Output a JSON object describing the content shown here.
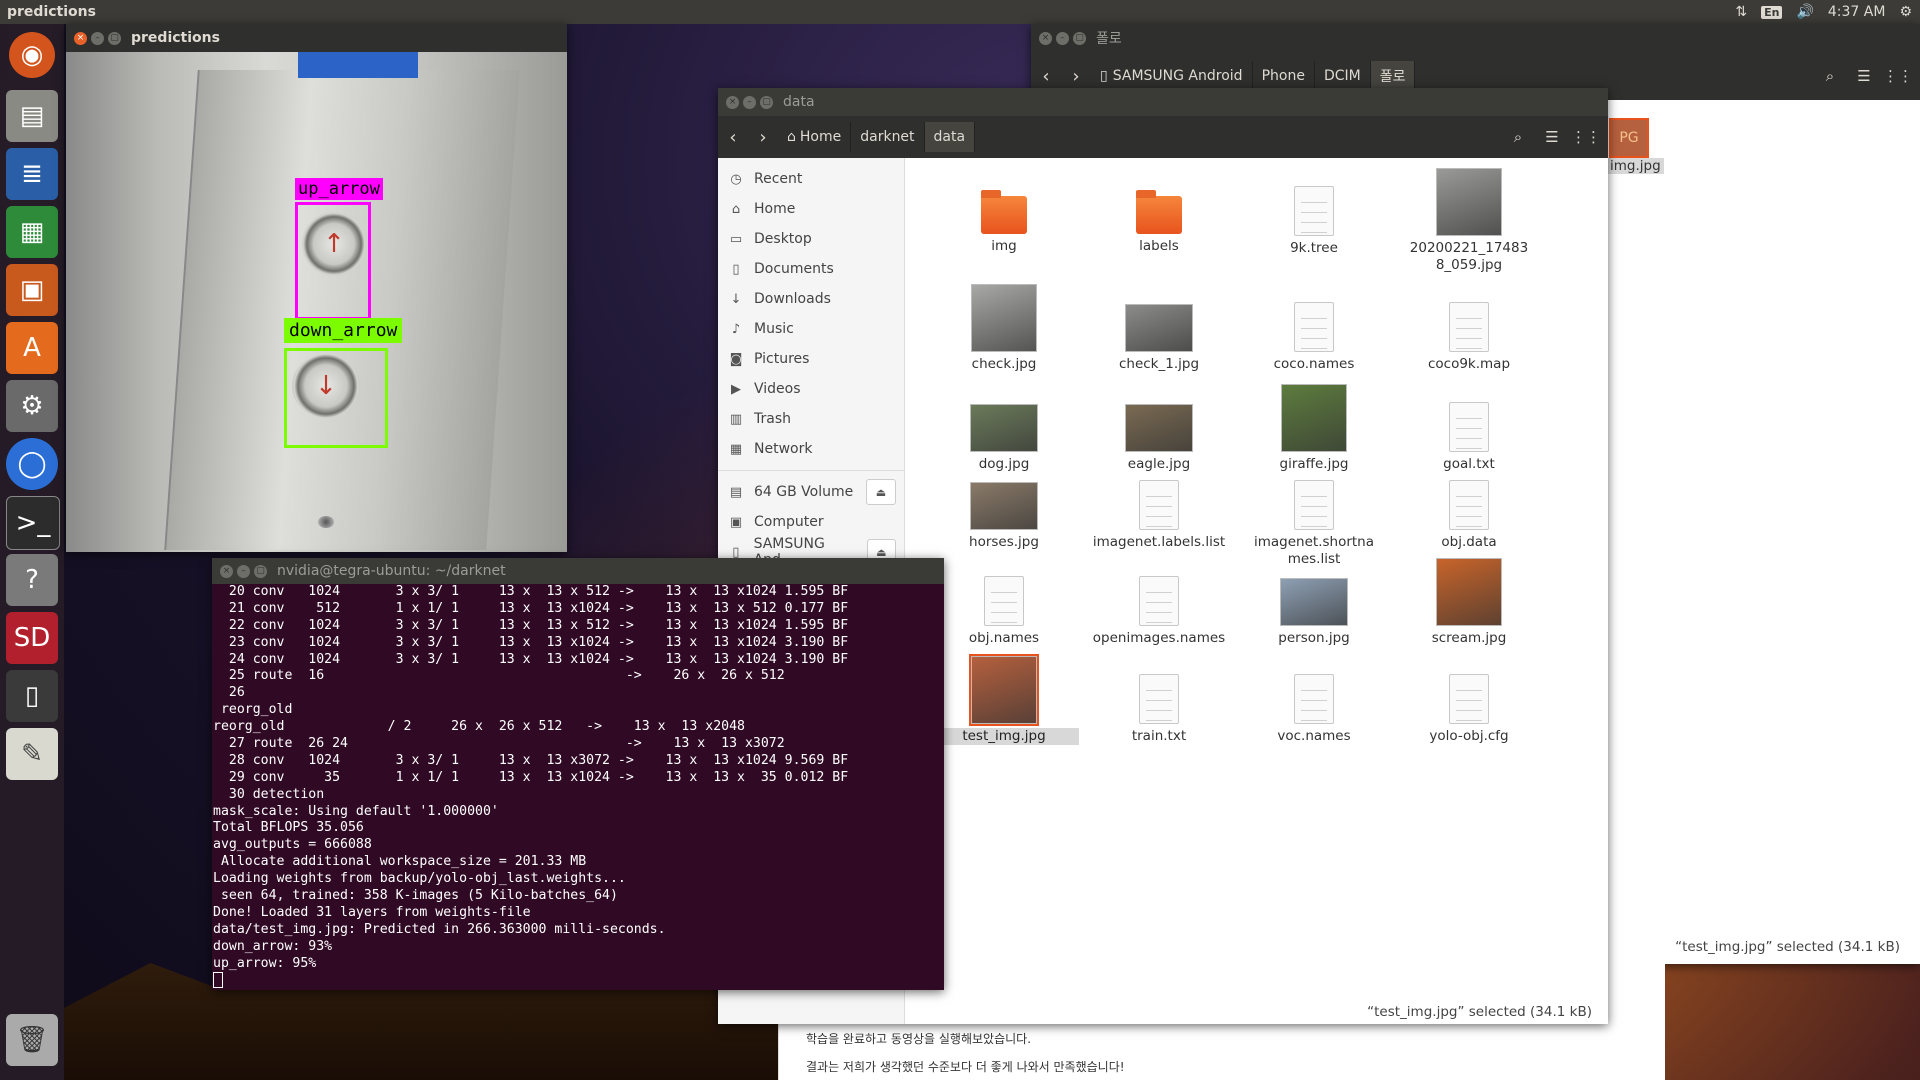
{
  "topbar": {
    "app_title": "predictions",
    "lang": "En",
    "time": "4:37 AM"
  },
  "launcher": {
    "items": [
      "ubuntu-dash-icon",
      "files-icon",
      "writer-icon",
      "calc-icon",
      "impress-icon",
      "software-center-icon",
      "settings-icon",
      "chromium-icon",
      "terminal-icon",
      "help-icon",
      "sd-card-icon",
      "phone-icon",
      "text-editor-icon",
      "trash-icon"
    ]
  },
  "predictions_window": {
    "title": "predictions",
    "detections": [
      {
        "label": "up_arrow",
        "color": "#ff00ff"
      },
      {
        "label": "down_arrow",
        "color": "#7cfc00"
      }
    ]
  },
  "terminal": {
    "title": "nvidia@tegra-ubuntu: ~/darknet",
    "lines": [
      "  20 conv   1024       3 x 3/ 1     13 x  13 x 512 ->    13 x  13 x1024 1.595 BF",
      "  21 conv    512       1 x 1/ 1     13 x  13 x1024 ->    13 x  13 x 512 0.177 BF",
      "  22 conv   1024       3 x 3/ 1     13 x  13 x 512 ->    13 x  13 x1024 1.595 BF",
      "  23 conv   1024       3 x 3/ 1     13 x  13 x1024 ->    13 x  13 x1024 3.190 BF",
      "  24 conv   1024       3 x 3/ 1     13 x  13 x1024 ->    13 x  13 x1024 3.190 BF",
      "  25 route  16                                      ->    26 x  26 x 512",
      "  26",
      " reorg_old",
      "reorg_old             / 2     26 x  26 x 512   ->    13 x  13 x2048",
      "  27 route  26 24                                   ->    13 x  13 x3072",
      "  28 conv   1024       3 x 3/ 1     13 x  13 x3072 ->    13 x  13 x1024 9.569 BF",
      "  29 conv     35       1 x 1/ 1     13 x  13 x1024 ->    13 x  13 x  35 0.012 BF",
      "  30 detection",
      "mask_scale: Using default '1.000000'",
      "Total BFLOPS 35.056",
      "avg_outputs = 666088",
      " Allocate additional workspace_size = 201.33 MB",
      "Loading weights from backup/yolo-obj_last.weights...",
      " seen 64, trained: 358 K-images (5 Kilo-batches_64)",
      "Done! Loaded 31 layers from weights-file",
      "data/test_img.jpg: Predicted in 266.363000 milli-seconds.",
      "down_arrow: 93%",
      "up_arrow: 95%"
    ]
  },
  "back_window": {
    "title": "폴로",
    "breadcrumbs": [
      "SAMSUNG Android",
      "Phone",
      "DCIM",
      "폴로"
    ],
    "partial_file": "img.jpg",
    "partial_thumb_text": "PG",
    "status": "“test_img.jpg” selected  (34.1 kB)"
  },
  "file_manager": {
    "title": "data",
    "breadcrumbs": [
      "Home",
      "darknet",
      "data"
    ],
    "sidebar": [
      {
        "label": "Recent",
        "icon": "clock-icon"
      },
      {
        "label": "Home",
        "icon": "home-icon"
      },
      {
        "label": "Desktop",
        "icon": "folder-icon"
      },
      {
        "label": "Documents",
        "icon": "document-icon"
      },
      {
        "label": "Downloads",
        "icon": "download-icon"
      },
      {
        "label": "Music",
        "icon": "music-icon"
      },
      {
        "label": "Pictures",
        "icon": "camera-icon"
      },
      {
        "label": "Videos",
        "icon": "video-icon"
      },
      {
        "label": "Trash",
        "icon": "trash-icon"
      },
      {
        "label": "Network",
        "icon": "network-icon"
      }
    ],
    "devices": [
      {
        "label": "64 GB Volume",
        "icon": "drive-icon"
      },
      {
        "label": "Computer",
        "icon": "computer-icon"
      },
      {
        "label": "SAMSUNG And...",
        "icon": "phone-icon"
      }
    ],
    "files": [
      {
        "name": "img",
        "kind": "folder"
      },
      {
        "name": "labels",
        "kind": "folder"
      },
      {
        "name": "9k.tree",
        "kind": "doc"
      },
      {
        "name": "20200221_174838_059.jpg",
        "kind": "thumb",
        "color": "#9a9a98"
      },
      {
        "name": "check.jpg",
        "kind": "thumb",
        "color": "#a8a8a6"
      },
      {
        "name": "check_1.jpg",
        "kind": "thumb",
        "color": "#8c8c8a"
      },
      {
        "name": "coco.names",
        "kind": "doc"
      },
      {
        "name": "coco9k.map",
        "kind": "doc"
      },
      {
        "name": "dog.jpg",
        "kind": "thumb",
        "color": "#6b7a5a"
      },
      {
        "name": "eagle.jpg",
        "kind": "thumb",
        "color": "#7a6a52"
      },
      {
        "name": "giraffe.jpg",
        "kind": "thumb",
        "color": "#5d7c3e"
      },
      {
        "name": "goal.txt",
        "kind": "doc"
      },
      {
        "name": "horses.jpg",
        "kind": "thumb",
        "color": "#8a7a68"
      },
      {
        "name": "imagenet.labels.list",
        "kind": "doc"
      },
      {
        "name": "imagenet.shortnames.list",
        "kind": "doc"
      },
      {
        "name": "obj.data",
        "kind": "doc"
      },
      {
        "name": "obj.names",
        "kind": "doc"
      },
      {
        "name": "openimages.names",
        "kind": "doc"
      },
      {
        "name": "person.jpg",
        "kind": "thumb",
        "color": "#8ea0b4"
      },
      {
        "name": "scream.jpg",
        "kind": "thumb",
        "color": "#c8642a"
      },
      {
        "name": "test_img.jpg",
        "kind": "thumb",
        "color": "#b5603e",
        "selected": true
      },
      {
        "name": "train.txt",
        "kind": "doc"
      },
      {
        "name": "voc.names",
        "kind": "doc"
      },
      {
        "name": "yolo-obj.cfg",
        "kind": "doc"
      }
    ],
    "status": "“test_img.jpg” selected  (34.1 kB)"
  },
  "blog": {
    "line1": "학습을 완료하고 동영상을 실행해보았습니다.",
    "line2": "결과는 저희가 생각했던 수준보다 더 좋게 나와서 만족했습니다!"
  }
}
